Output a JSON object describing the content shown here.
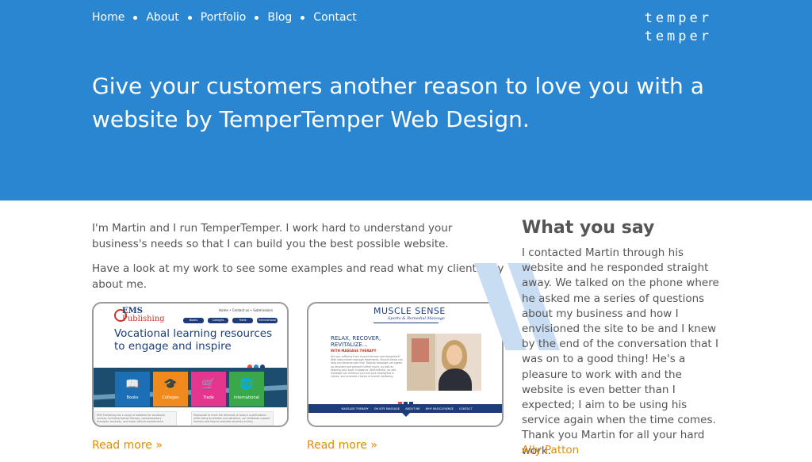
{
  "nav": {
    "items": [
      {
        "label": "Home"
      },
      {
        "label": "About"
      },
      {
        "label": "Portfolio"
      },
      {
        "label": "Blog"
      },
      {
        "label": "Contact"
      }
    ]
  },
  "logo": {
    "line1": "temper",
    "line2": "temper"
  },
  "hero": {
    "headline": "Give your customers another reason to love you with a website by TemperTemper Web Design."
  },
  "intro": {
    "p1": "I'm Martin and I run TemperTemper. I work hard to understand your business's needs so that I can build you the best possible website.",
    "p2": "Have a look at my work to see some examples and read what my clients say about me."
  },
  "portfolio": [
    {
      "read_more": "Read more »",
      "thumb": {
        "logo_line1": "EMS",
        "logo_line2": "Publishing",
        "topnav": "Home  •  Contact us  •  Submissions",
        "pills": [
          "Books",
          "Colleges",
          "Trade",
          "International"
        ],
        "headline": "Vocational learning resources to engage and inspire",
        "tiles": [
          {
            "label": "Books",
            "color": "#1a6fb5",
            "icon": "book-icon",
            "glyph": "📖"
          },
          {
            "label": "Colleges",
            "color": "#f08a1c",
            "icon": "graduation-cap-icon",
            "glyph": "🎓"
          },
          {
            "label": "Trade",
            "color": "#e4358f",
            "icon": "cart-icon",
            "glyph": "🛒"
          },
          {
            "label": "International",
            "color": "#3aa84a",
            "icon": "globe-icon",
            "glyph": "🌐"
          }
        ],
        "dot_colors": [
          "#e74c3c",
          "#2a86d1",
          "#1d3d7a"
        ],
        "text1": "EMS Publishing has a range of websites for vocational courses, including beauty therapy, complementary therapies, business, and motor vehicle maintenance.",
        "text2": "Passionate to meet the demands of today's qualifications while being accessible and attractive, our textbooks support learners and help to motivate students as they"
      }
    },
    {
      "read_more": "Read more »",
      "thumb": {
        "logo": "MUSCLE SENSE",
        "sub": "Sports & Remedial Massage",
        "head": "RELAX, RECOVER, REVITALIZE...",
        "tag": "WITH MASSAGE THERAPY",
        "para": "Are you suffering from muscle tension and discomfort? With tailor-made massage treatments, Muscle Sense can help you become pain free. Regular massage can speed up recovery and prevent further injury, as well as keeping your body in balance. Alternatively, on-site massage can enhance you and your employees in clients, and promote a sense of overall wellbeing.",
        "square_colors": [
          "#e74c3c",
          "#1d3d7a",
          "#1d3d7a"
        ],
        "nav": [
          "MASSAGE THERAPY",
          "ON SITE MASSAGE",
          "ABOUT ME",
          "WHY MUSCLESENSE",
          "CONTACT"
        ]
      }
    }
  ],
  "testimonial": {
    "title": "What you say",
    "text": "I contacted Martin through his website and he responded straight away. We talked on the phone where he asked me a series of questions about my business and how I envisioned the site to be and I knew by the end of the conversation that I was on to a good thing! He's a pleasure to work with and the website is even better than I expected; I aim to be using his service again when the time comes. Thank you Martin for all your hard work.",
    "author": "Ally Patton"
  },
  "colors": {
    "hero_bg": "#2a86d1",
    "accent": "#e68a00",
    "quote_mark": "#c8dcf2"
  }
}
